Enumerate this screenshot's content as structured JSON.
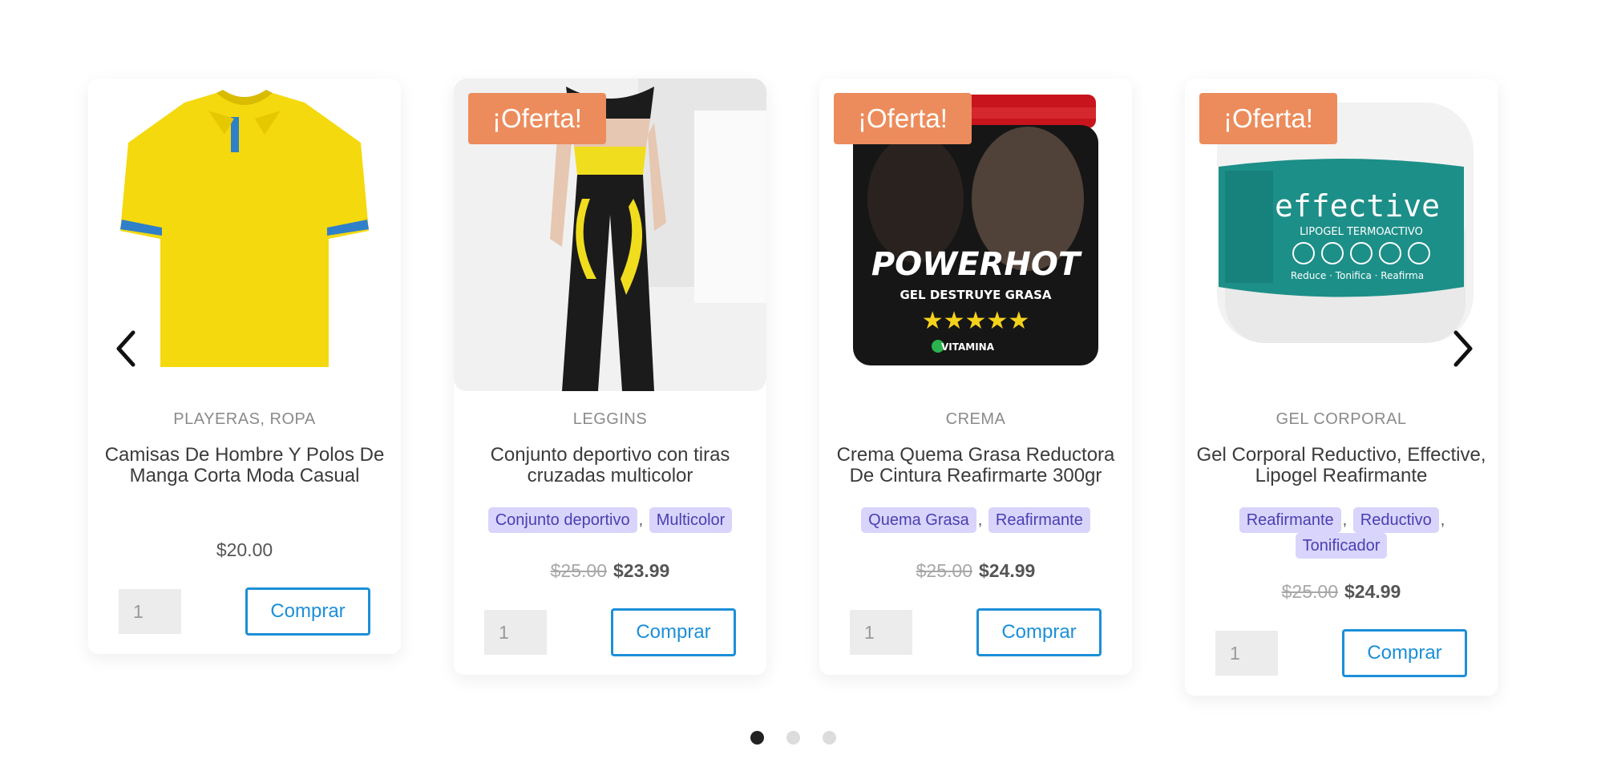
{
  "sale_badge": "¡Oferta!",
  "buy_label": "Comprar",
  "qty_default": "1",
  "products": [
    {
      "category": "PLAYERAS, ROPA",
      "title": "Camisas De Hombre Y Polos De Manga Corta Moda Casual",
      "tags": [],
      "price": "$20.00",
      "old_price": "",
      "sale": false
    },
    {
      "category": "LEGGINS",
      "title": "Conjunto deportivo con tiras cruzadas multicolor",
      "tags": [
        "Conjunto deportivo",
        "Multicolor"
      ],
      "price": "$23.99",
      "old_price": "$25.00",
      "sale": true
    },
    {
      "category": "CREMA",
      "title": "Crema Quema Grasa Reductora De Cintura Reafirmarte 300gr",
      "tags": [
        "Quema Grasa",
        "Reafirmante"
      ],
      "price": "$24.99",
      "old_price": "$25.00",
      "sale": true
    },
    {
      "category": "GEL CORPORAL",
      "title": "Gel Corporal Reductivo, Effective, Lipogel Reafirmante",
      "tags": [
        "Reafirmante",
        "Reductivo",
        "Tonificador"
      ],
      "price": "$24.99",
      "old_price": "$25.00",
      "sale": true
    }
  ],
  "product_image_text": {
    "power_hot_brand": "POWERHOT",
    "power_hot_sub": "GEL DESTRUYE GRASA",
    "power_hot_stars": "★★★★★",
    "power_hot_vit": "VITAMINA",
    "effective_brand": "effective",
    "effective_sub": "LIPOGEL TERMOACTIVO",
    "effective_line": "Reduce · Tonifica · Reafirma"
  },
  "pagination": {
    "count": 3,
    "active_index": 0
  },
  "colors": {
    "sale_badge": "#ec8c5c",
    "buy_border": "#1c8fd8",
    "tag_bg": "#d9d4fb",
    "tag_text": "#4a3fb0"
  }
}
